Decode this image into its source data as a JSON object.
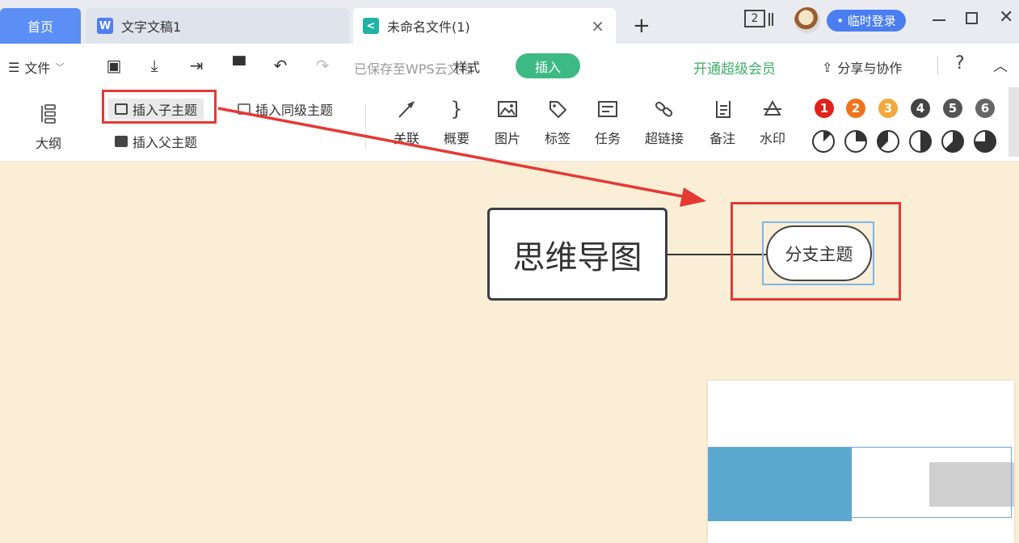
{
  "tabs": {
    "home": "首页",
    "doc": "文字文稿1",
    "doc_icon": "W",
    "mind": "未命名文件(1)",
    "mind_icon": "<",
    "close": "×",
    "new": "+"
  },
  "titlebar": {
    "screen_count": "2",
    "login": "• 临时登录",
    "minimize_icon": "minimize-icon",
    "maximize_icon": "maximize-icon",
    "close": "✕"
  },
  "menu": {
    "file": "文件",
    "file_icon": "☰",
    "chevron": "﹀",
    "saved": "已保存至WPS云文档",
    "style_tab": "样式",
    "insert_tab": "插入",
    "vip": "开通超级会员",
    "share": "分享与协作",
    "share_icon": "⇪",
    "help": "?",
    "collapse": "︿"
  },
  "quick_actions": [
    {
      "name": "save-icon",
      "glyph": "▣"
    },
    {
      "name": "download-icon",
      "glyph": "⤓"
    },
    {
      "name": "export-icon",
      "glyph": "⇥"
    },
    {
      "name": "format-painter-icon",
      "glyph": "▀"
    },
    {
      "name": "undo-icon",
      "glyph": "↶"
    },
    {
      "name": "redo-icon",
      "glyph": "↷"
    }
  ],
  "ribbon": {
    "outline": "大纲",
    "insert_child": "插入子主题",
    "insert_sibling": "插入同级主题",
    "insert_parent": "插入父主题",
    "relation": "关联",
    "summary": "概要",
    "image": "图片",
    "tag": "标签",
    "task": "任务",
    "hyperlink": "超链接",
    "note": "备注",
    "watermark": "水印",
    "priorities": [
      "1",
      "2",
      "3",
      "4",
      "5",
      "6"
    ],
    "priority_colors": [
      "#e0231c",
      "#f0731b",
      "#f2a93b",
      "#444444",
      "#555555",
      "#666666"
    ]
  },
  "canvas": {
    "root": "思维导图",
    "branch": "分支主题"
  },
  "colors": {
    "accent_blue": "#4a7ef0",
    "insert_green": "#3dba83",
    "highlight_red": "#e53935",
    "canvas_bg": "#faefd6"
  }
}
